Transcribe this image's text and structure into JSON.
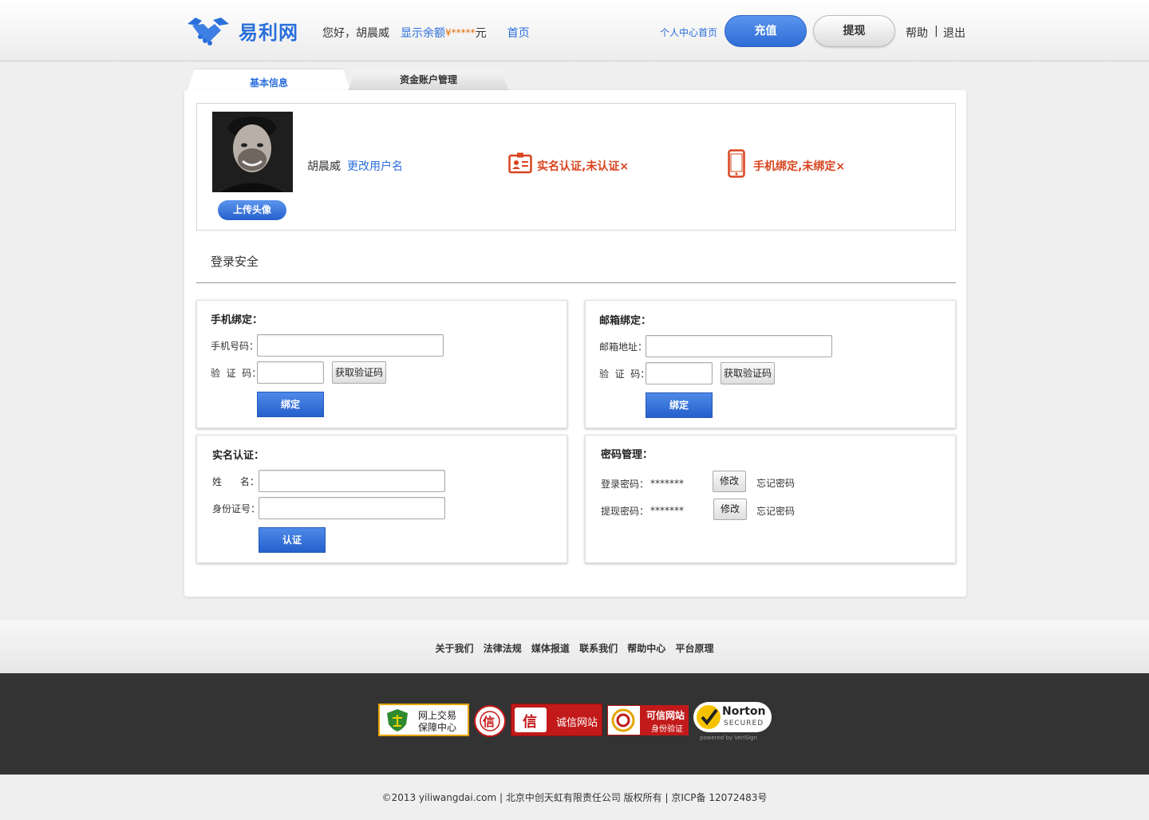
{
  "header": {
    "logo_text": "易利网",
    "greeting": "您好，胡晨威",
    "show_balance_label": "显示余额",
    "currency_symbol": "¥",
    "balance_masked": "*****",
    "currency_unit": "元",
    "home_link": "首页",
    "user_center_link": "个人中心首页",
    "recharge_label": "充值",
    "withdraw_label": "提现",
    "help_label": "帮助",
    "separator": "|",
    "logout_label": "退出"
  },
  "tabs": [
    {
      "label": "基本信息",
      "active": true
    },
    {
      "label": "资金账户管理",
      "active": false
    }
  ],
  "profile": {
    "upload_avatar_label": "上传头像",
    "username": "胡晨威",
    "change_username_label": "更改用户名",
    "realname_status": "实名认证,未认证",
    "phone_status": "手机绑定,未绑定",
    "status_mark": "×"
  },
  "security": {
    "title": "登录安全",
    "phone_panel": {
      "title": "手机绑定：",
      "phone_label": "手机号码：",
      "code_label": "验  证  码：",
      "get_code_label": "获取验证码",
      "bind_label": "绑定"
    },
    "email_panel": {
      "title": "邮箱绑定：",
      "email_label": "邮箱地址：",
      "code_label": "验  证  码：",
      "get_code_label": "获取验证码",
      "bind_label": "绑定"
    },
    "realname_panel": {
      "title": "实名认证：",
      "name_label": "姓      名：",
      "id_label": "身份证号：",
      "verify_label": "认证"
    },
    "password_panel": {
      "title": "密码管理：",
      "login_pwd_label": "登录密码：",
      "login_pwd_value": "*******",
      "withdraw_pwd_label": "提现密码：",
      "withdraw_pwd_value": "*******",
      "modify_label": "修改",
      "forgot_label": "忘记密码"
    }
  },
  "footer": {
    "links": [
      "关于我们",
      "法律法规",
      "媒体报道",
      "联系我们",
      "帮助中心",
      "平台原理"
    ],
    "badges": {
      "trade_center_line1": "网上交易",
      "trade_center_line2": "保障中心",
      "seal_text": "信",
      "integrity_label": "诚信网站",
      "trusted_line1": "可信网站",
      "trusted_line2": "身份验证",
      "norton_brand": "Norton",
      "norton_secured": "SECURED",
      "norton_powered": "powered by VeriSign"
    },
    "copyright": "©2013 yiliwangdai.com | 北京中创天虹有限责任公司 版权所有 | 京ICP备 12072483号"
  },
  "colors": {
    "brand_blue": "#2a6fdb",
    "alert_red": "#d9441f",
    "money_orange": "#e36b00",
    "footer_dark": "#333333"
  }
}
